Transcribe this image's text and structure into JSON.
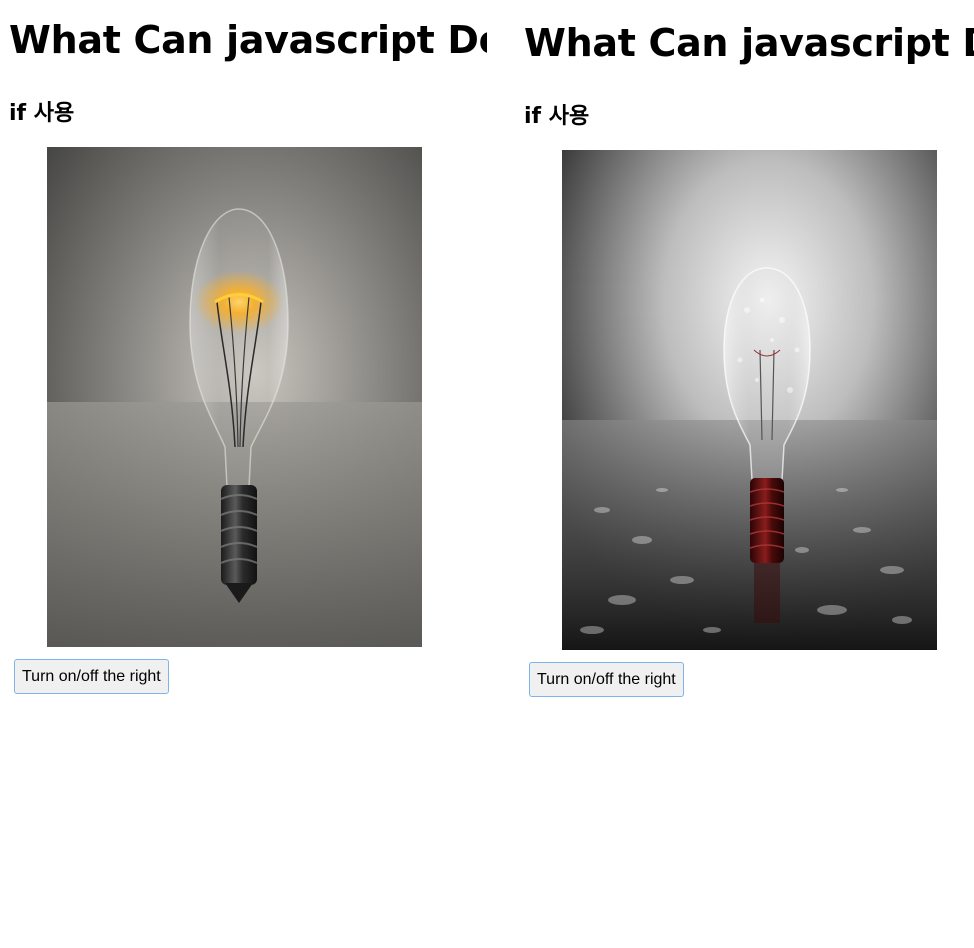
{
  "panels": [
    {
      "title": "What Can javascript Do?",
      "subtitle": "if 사용",
      "image_alt": "lit light bulb",
      "bulb_state": "on",
      "button_label": "Turn on/off the right"
    },
    {
      "title": "What Can javascript Do?",
      "subtitle": "if 사용",
      "image_alt": "unlit light bulb with water droplets",
      "bulb_state": "off",
      "button_label": "Turn on/off the right"
    }
  ],
  "colors": {
    "button_border": "#7eb4ea",
    "button_bg": "#f0f0f0",
    "glow": "#ffb020"
  }
}
